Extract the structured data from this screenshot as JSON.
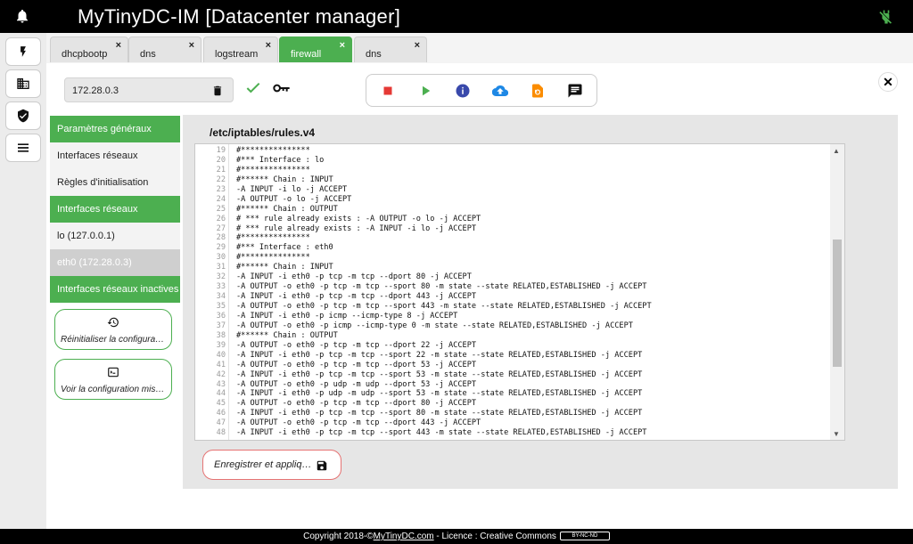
{
  "app": {
    "title": "MyTinyDC-IM [Datacenter manager]"
  },
  "colors": {
    "accent": "#4caf50",
    "danger": "#e53935",
    "info": "#3949ab",
    "upload": "#1e88e5",
    "warning": "#fb8c00"
  },
  "nav": [
    {
      "icon": "bolt-icon"
    },
    {
      "icon": "building-icon"
    },
    {
      "icon": "shield-icon"
    },
    {
      "icon": "list-icon"
    }
  ],
  "tabs": [
    {
      "label": "dhcpbootp",
      "close": "×",
      "active": false
    },
    {
      "label": "dns",
      "close": "×",
      "active": false
    },
    {
      "label": "logstream",
      "close": "×",
      "active": false
    },
    {
      "label": "firewall",
      "close": "×",
      "active": true
    },
    {
      "label": "dns",
      "close": "×",
      "active": false
    }
  ],
  "host": {
    "ip": "172.28.0.3"
  },
  "close_all": "✕",
  "menu": [
    {
      "label": "Paramètres généraux",
      "style": "green"
    },
    {
      "label": "Interfaces réseaux",
      "style": "plain"
    },
    {
      "label": "Règles d'initialisation",
      "style": "plain"
    },
    {
      "label": "Interfaces réseaux",
      "style": "green"
    },
    {
      "label": "lo (127.0.0.1)",
      "style": "plain"
    },
    {
      "label": "eth0 (172.28.0.3)",
      "style": "sel"
    },
    {
      "label": "Interfaces réseaux inactives",
      "style": "green"
    }
  ],
  "side_buttons": {
    "reset": "Réinitialiser la configuration",
    "view": "Voir la configuration mise en place"
  },
  "editor": {
    "path": "/etc/iptables/rules.v4",
    "lines": [
      {
        "n": "19",
        "t": "#***************"
      },
      {
        "n": "20",
        "t": "#*** Interface : lo"
      },
      {
        "n": "21",
        "t": "#***************"
      },
      {
        "n": "22",
        "t": "#****** Chain : INPUT"
      },
      {
        "n": "23",
        "t": "-A INPUT -i lo -j ACCEPT"
      },
      {
        "n": "24",
        "t": "-A OUTPUT -o lo -j ACCEPT"
      },
      {
        "n": "25",
        "t": "#****** Chain : OUTPUT"
      },
      {
        "n": "26",
        "t": "# *** rule already exists : -A OUTPUT -o lo -j ACCEPT"
      },
      {
        "n": "27",
        "t": "# *** rule already exists : -A INPUT -i lo -j ACCEPT"
      },
      {
        "n": "28",
        "t": "#***************"
      },
      {
        "n": "29",
        "t": "#*** Interface : eth0"
      },
      {
        "n": "30",
        "t": "#***************"
      },
      {
        "n": "31",
        "t": "#****** Chain : INPUT"
      },
      {
        "n": "32",
        "t": "-A INPUT -i eth0 -p tcp -m tcp --dport 80 -j ACCEPT"
      },
      {
        "n": "33",
        "t": "-A OUTPUT -o eth0 -p tcp -m tcp --sport 80 -m state --state RELATED,ESTABLISHED -j ACCEPT"
      },
      {
        "n": "34",
        "t": "-A INPUT -i eth0 -p tcp -m tcp --dport 443 -j ACCEPT"
      },
      {
        "n": "35",
        "t": "-A OUTPUT -o eth0 -p tcp -m tcp --sport 443 -m state --state RELATED,ESTABLISHED -j ACCEPT"
      },
      {
        "n": "36",
        "t": "-A INPUT -i eth0 -p icmp --icmp-type 8 -j ACCEPT"
      },
      {
        "n": "37",
        "t": "-A OUTPUT -o eth0 -p icmp --icmp-type 0 -m state --state RELATED,ESTABLISHED -j ACCEPT"
      },
      {
        "n": "38",
        "t": "#****** Chain : OUTPUT"
      },
      {
        "n": "39",
        "t": "-A OUTPUT -o eth0 -p tcp -m tcp --dport 22 -j ACCEPT"
      },
      {
        "n": "40",
        "t": "-A INPUT -i eth0 -p tcp -m tcp --sport 22 -m state --state RELATED,ESTABLISHED -j ACCEPT"
      },
      {
        "n": "41",
        "t": "-A OUTPUT -o eth0 -p tcp -m tcp --dport 53 -j ACCEPT"
      },
      {
        "n": "42",
        "t": "-A INPUT -i eth0 -p tcp -m tcp --sport 53 -m state --state RELATED,ESTABLISHED -j ACCEPT"
      },
      {
        "n": "43",
        "t": "-A OUTPUT -o eth0 -p udp -m udp --dport 53 -j ACCEPT"
      },
      {
        "n": "44",
        "t": "-A INPUT -i eth0 -p udp -m udp --sport 53 -m state --state RELATED,ESTABLISHED -j ACCEPT"
      },
      {
        "n": "45",
        "t": "-A OUTPUT -o eth0 -p tcp -m tcp --dport 80 -j ACCEPT"
      },
      {
        "n": "46",
        "t": "-A INPUT -i eth0 -p tcp -m tcp --sport 80 -m state --state RELATED,ESTABLISHED -j ACCEPT"
      },
      {
        "n": "47",
        "t": "-A OUTPUT -o eth0 -p tcp -m tcp --dport 443 -j ACCEPT"
      },
      {
        "n": "48",
        "t": "-A INPUT -i eth0 -p tcp -m tcp --sport 443 -m state --state RELATED,ESTABLISHED -j ACCEPT"
      }
    ]
  },
  "save_label": "Enregistrer et appliquer",
  "footer": {
    "prefix": "Copyright 2018-©",
    "link": "MyTinyDC.com",
    "suffix": " - Licence : Creative Commons",
    "badge": "BY-NC-ND"
  }
}
